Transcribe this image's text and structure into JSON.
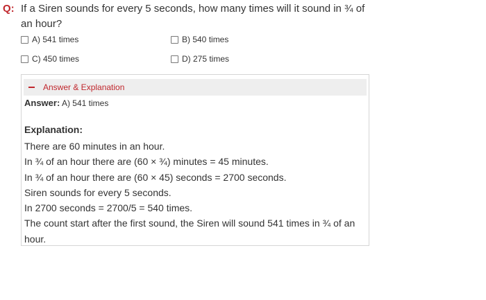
{
  "question": {
    "label": "Q:",
    "text": "If a Siren sounds for every 5 seconds, how many times will it sound in ¾ of an hour?"
  },
  "options": [
    {
      "label": "A) 541 times"
    },
    {
      "label": "B) 540 times"
    },
    {
      "label": "C) 450 times"
    },
    {
      "label": "D) 275 times"
    }
  ],
  "panel": {
    "header": "Answer & Explanation",
    "answer_label": "Answer:",
    "answer_value": "A) 541 times",
    "explanation_title": "Explanation:",
    "lines": [
      "There are 60 minutes in an hour.",
      "In ¾ of an hour there are (60 × ¾) minutes = 45 minutes.",
      "In ¾ of an hour there are (60 × 45) seconds = 2700 seconds.",
      "Siren sounds for every 5 seconds.",
      "In 2700 seconds = 2700/5 = 540 times.",
      "The count start after the first sound, the Siren will sound 541 times in ¾ of an hour."
    ]
  },
  "colors": {
    "accent": "#c0272d",
    "header_bg": "#eeeeee",
    "border": "#d5d5d5",
    "text": "#333333"
  }
}
